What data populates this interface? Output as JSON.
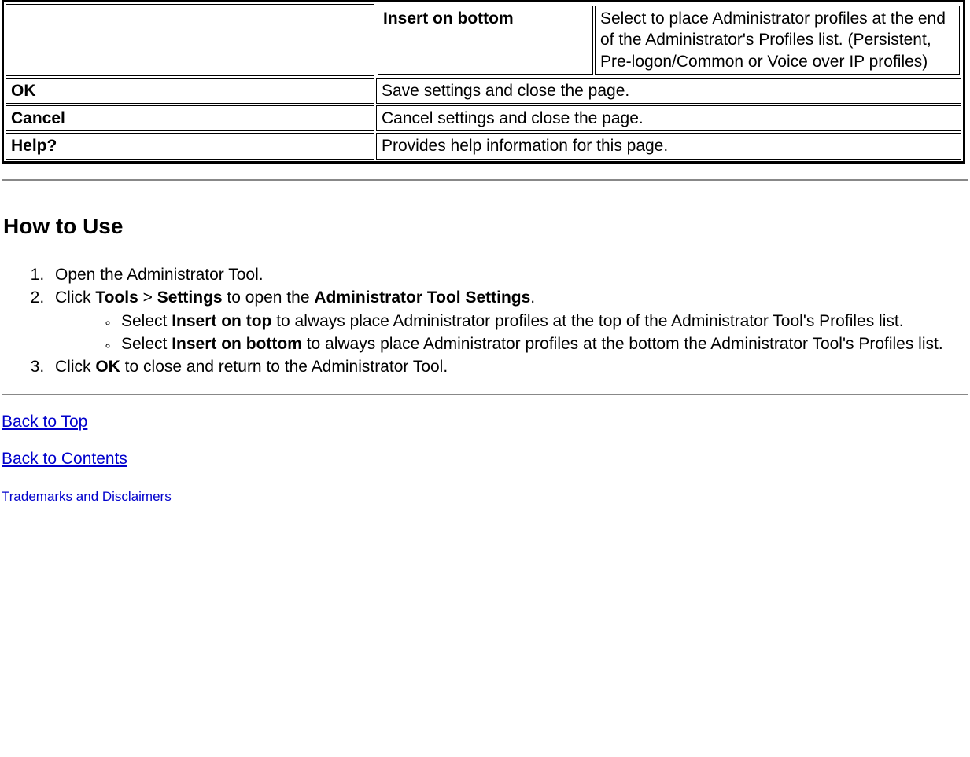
{
  "table": {
    "row_insert_bottom": {
      "label": "Insert on bottom",
      "desc": "Select to place Administrator profiles at the end of the Administrator's Profiles list. (Persistent, Pre-logon/Common or Voice over IP profiles)"
    },
    "row_ok": {
      "label": "OK",
      "desc": "Save settings and close the page."
    },
    "row_cancel": {
      "label": "Cancel",
      "desc": "Cancel settings and close the page."
    },
    "row_help": {
      "label": "Help?",
      "desc": "Provides help information for this page."
    }
  },
  "heading": "How to Use",
  "steps": {
    "s1": "Open the Administrator Tool.",
    "s2_pre": "Click ",
    "s2_b1": "Tools",
    "s2_gt": " > ",
    "s2_b2": "Settings",
    "s2_mid": " to open the ",
    "s2_b3": "Administrator Tool Settings",
    "s2_post": ".",
    "s2a_pre": "Select ",
    "s2a_b": "Insert on top",
    "s2a_post": " to always place Administrator profiles at the top of the Administrator Tool's Profiles list.",
    "s2b_pre": "Select ",
    "s2b_b": "Insert on bottom",
    "s2b_post": " to always place Administrator profiles at the bottom the Administrator Tool's Profiles list.",
    "s3_pre": "Click ",
    "s3_b": "OK",
    "s3_post": " to close and return to the Administrator Tool."
  },
  "links": {
    "back_top": "Back to Top",
    "back_contents": "Back to Contents",
    "trademarks": "Trademarks and Disclaimers"
  }
}
